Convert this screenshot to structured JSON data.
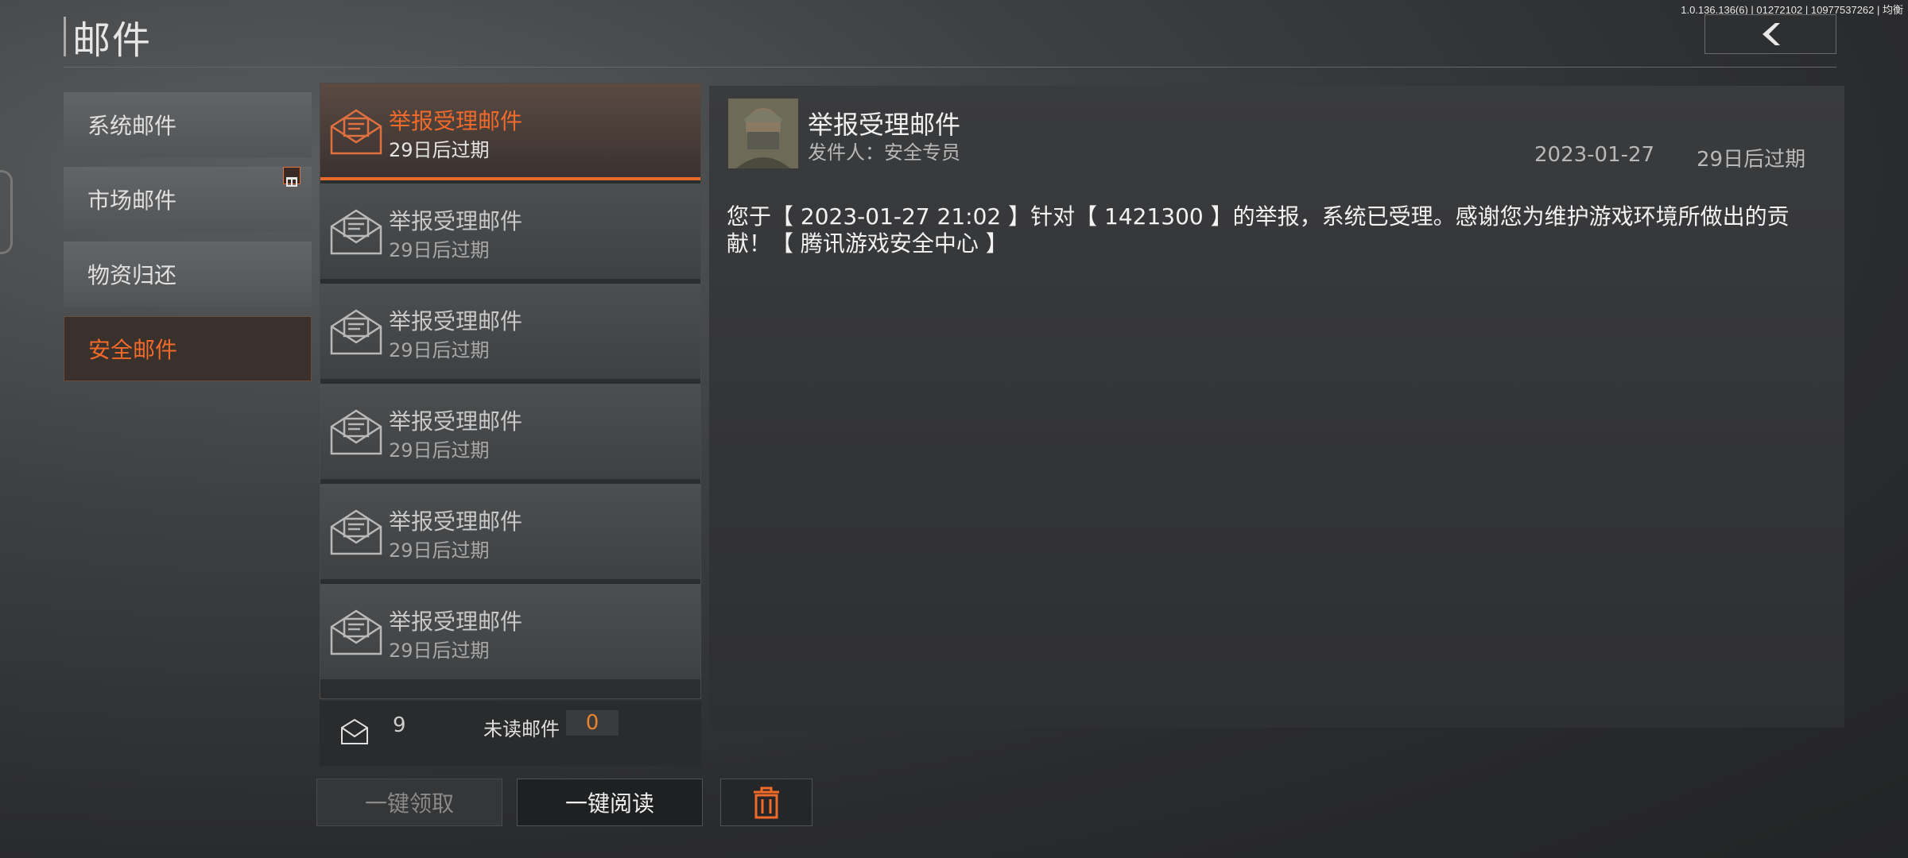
{
  "version": "1.0.136.136(6) | 01272102 | 10977537262 | 均衡",
  "title": "邮件",
  "categories": [
    {
      "label": "系统邮件",
      "active": false
    },
    {
      "label": "市场邮件",
      "active": false,
      "has_gift_badge": true
    },
    {
      "label": "物资归还",
      "active": false
    },
    {
      "label": "安全邮件",
      "active": true
    }
  ],
  "mails": [
    {
      "name": "举报受理邮件",
      "expiry": "29日后过期",
      "active": true
    },
    {
      "name": "举报受理邮件",
      "expiry": "29日后过期",
      "active": false
    },
    {
      "name": "举报受理邮件",
      "expiry": "29日后过期",
      "active": false
    },
    {
      "name": "举报受理邮件",
      "expiry": "29日后过期",
      "active": false
    },
    {
      "name": "举报受理邮件",
      "expiry": "29日后过期",
      "active": false
    },
    {
      "name": "举报受理邮件",
      "expiry": "29日后过期",
      "active": false
    }
  ],
  "footer": {
    "mail_count": "9",
    "unread_label": "未读邮件",
    "unread_count": "0"
  },
  "buttons": {
    "claim_all": "一键领取",
    "read_all": "一键阅读",
    "delete": "trash-icon"
  },
  "detail": {
    "title": "举报受理邮件",
    "sender_label": "发件人：",
    "sender": "安全专员",
    "date": "2023-01-27",
    "expiry": "29日后过期",
    "body": "您于【 2023-01-27 21:02 】针对【 1421300 】的举报，系统已受理。感谢您为维护游戏环境所做出的贡献！【 腾讯游戏安全中心 】"
  },
  "colors": {
    "accent": "#f06a2a"
  }
}
